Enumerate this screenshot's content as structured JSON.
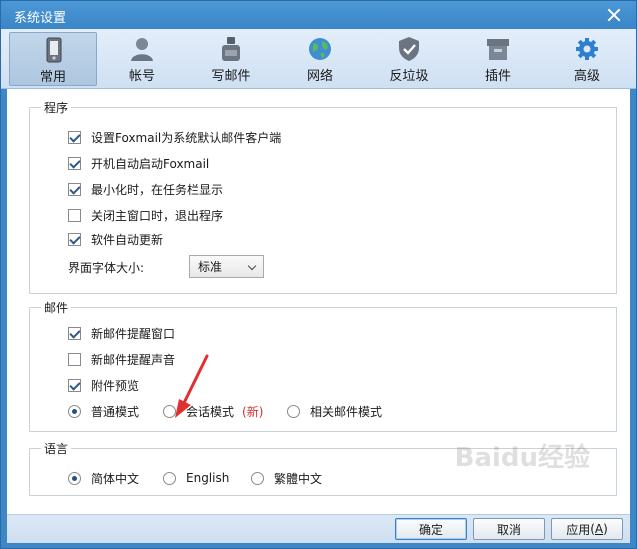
{
  "window": {
    "title": "系统设置"
  },
  "toolbar": {
    "items": [
      {
        "label": "常用",
        "icon": "phone-icon",
        "active": true
      },
      {
        "label": "帐号",
        "icon": "user-icon",
        "active": false
      },
      {
        "label": "写邮件",
        "icon": "ink-bottle-icon",
        "active": false
      },
      {
        "label": "网络",
        "icon": "globe-icon",
        "active": false
      },
      {
        "label": "反垃圾",
        "icon": "shield-icon",
        "active": false
      },
      {
        "label": "插件",
        "icon": "box-icon",
        "active": false
      },
      {
        "label": "高级",
        "icon": "gear-icon",
        "active": false
      }
    ]
  },
  "program": {
    "title": "程序",
    "options": [
      {
        "label": "设置Foxmail为系统默认邮件客户端",
        "checked": true
      },
      {
        "label": "开机自动启动Foxmail",
        "checked": true
      },
      {
        "label": "最小化时，在任务栏显示",
        "checked": true
      },
      {
        "label": "关闭主窗口时，退出程序",
        "checked": false
      },
      {
        "label": "软件自动更新",
        "checked": true
      }
    ],
    "font_size": {
      "label": "界面字体大小:",
      "value": "标准"
    }
  },
  "mail": {
    "title": "邮件",
    "options": [
      {
        "label": "新邮件提醒窗口",
        "checked": true
      },
      {
        "label": "新邮件提醒声音",
        "checked": false
      },
      {
        "label": "附件预览",
        "checked": true
      }
    ],
    "modes": [
      {
        "label": "普通模式",
        "checked": true
      },
      {
        "label": "会话模式",
        "checked": false,
        "badge": "(新)"
      },
      {
        "label": "相关邮件模式",
        "checked": false
      }
    ]
  },
  "language": {
    "title": "语言",
    "options": [
      {
        "label": "简体中文",
        "checked": true
      },
      {
        "label": "English",
        "checked": false
      },
      {
        "label": "繁體中文",
        "checked": false
      }
    ]
  },
  "footer": {
    "ok": "确定",
    "cancel": "取消",
    "apply": "应用",
    "apply_key": "A"
  },
  "watermark": "Baidu经验",
  "colors": {
    "titlebar": "#3d87c6",
    "accent_arrow": "#e03030",
    "new_badge": "#d03030"
  }
}
